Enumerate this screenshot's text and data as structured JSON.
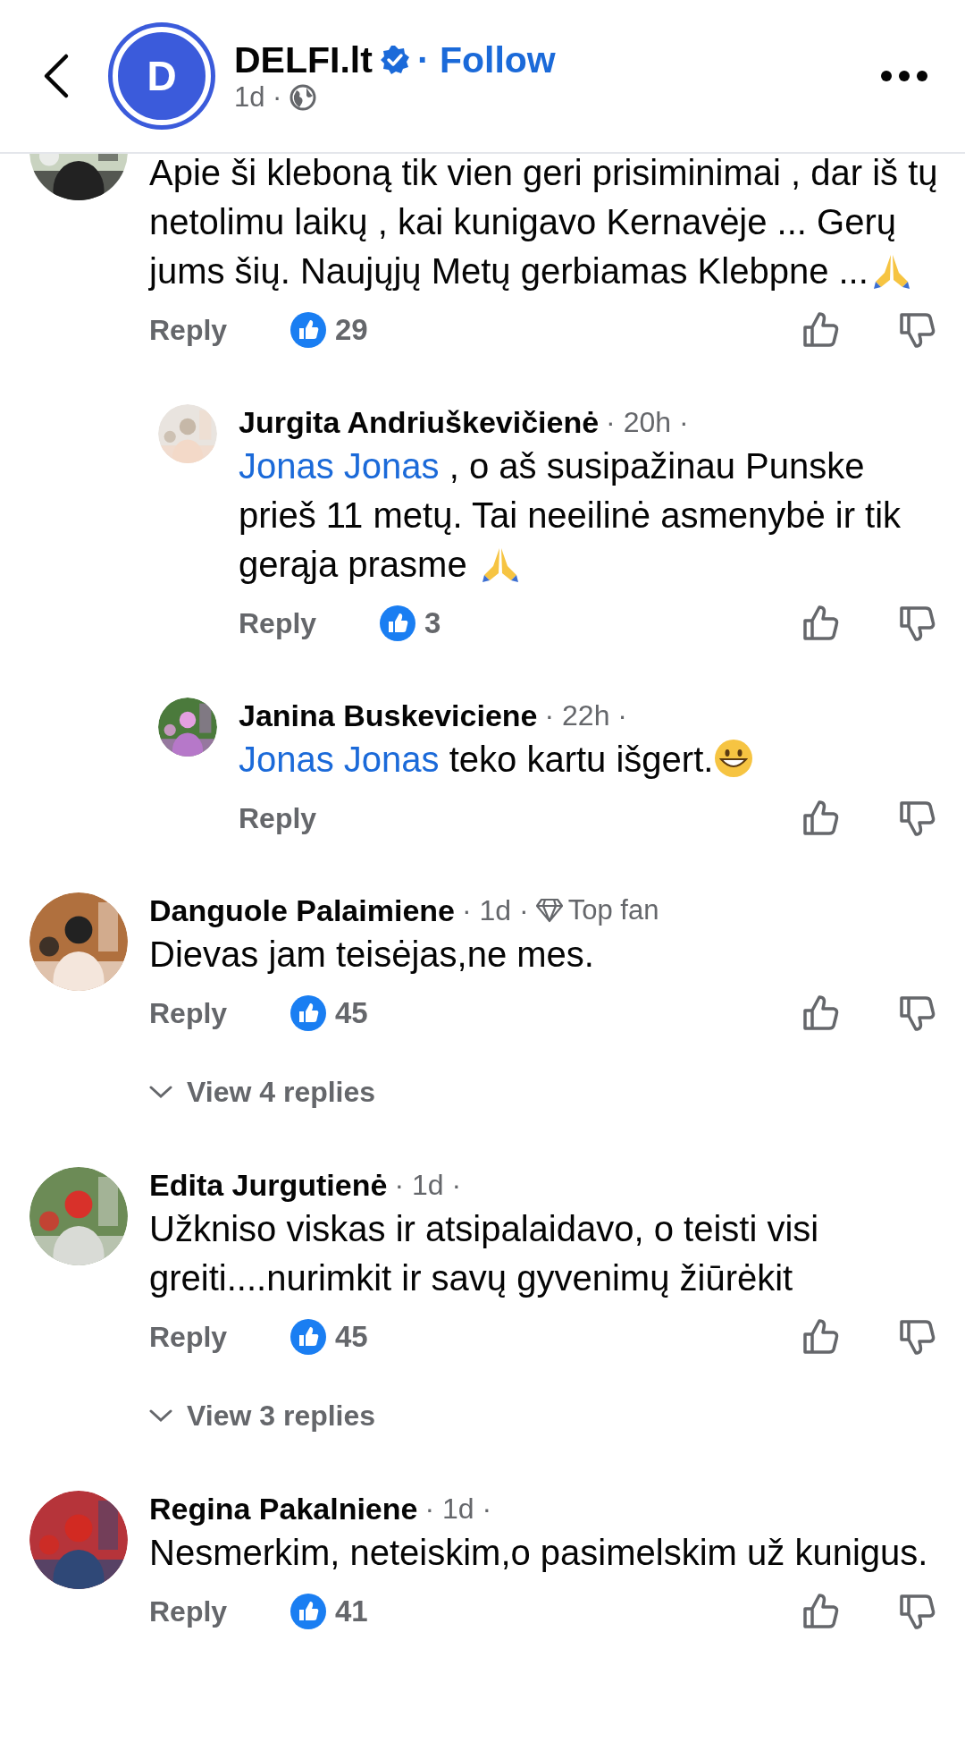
{
  "header": {
    "page_name": "DELFI.lt",
    "avatar_letter": "D",
    "verified": true,
    "follow": "· Follow",
    "age": "1d ·"
  },
  "comments": [
    {
      "kind": "top",
      "text": [
        {
          "text": "Apie ši kleboną tik vien geri prisiminimai , dar iš tų netolimu laikų , kai kunigavo Kernavėje ... Gerų jums šių. Naujųjų Metų gerbiamas Klebpne ..."
        }
      ],
      "emoji": {
        "kind": "pray"
      },
      "reply": "Reply",
      "likes": "29"
    },
    {
      "kind": "reply",
      "author": "Jurgita Andriuškevičienė",
      "meta": "· 20h ·",
      "text": [
        {
          "mention": "Jonas Jonas"
        },
        {
          "text": " , o aš susipažinau Punske prieš 11 metų. Tai neeilinė asmenybė ir tik gerąja prasme "
        }
      ],
      "emoji": {
        "kind": "pray"
      },
      "reply": "Reply",
      "likes": "3"
    },
    {
      "kind": "reply",
      "author": "Janina Buskeviciene",
      "meta": "· 22h ·",
      "text": [
        {
          "mention": "Jonas Jonas"
        },
        {
          "text": " teko kartu išgert."
        }
      ],
      "emoji": {
        "kind": "grin"
      },
      "reply": "Reply"
    },
    {
      "kind": "top",
      "author": "Danguole Palaimiene",
      "meta": "· 1d ·",
      "badge": "Top fan",
      "text": [
        {
          "text": "Dievas jam teisėjas,ne mes."
        }
      ],
      "reply": "Reply",
      "likes": "45",
      "view_replies": "View 4 replies"
    },
    {
      "kind": "top",
      "author": "Edita Jurgutienė",
      "meta": "· 1d ·",
      "text": [
        {
          "text": "Užkniso viskas ir atsipalaidavo, o teisti visi greiti....nurimkit ir savų gyvenimų žiūrėkit"
        }
      ],
      "reply": "Reply",
      "likes": "45",
      "view_replies": "View 3 replies"
    },
    {
      "kind": "top",
      "author": "Regina Pakalniene",
      "meta": "· 1d ·",
      "text": [
        {
          "text": "Nesmerkim, neteiskim,o pasimelskim už kunigus."
        }
      ],
      "reply": "Reply",
      "likes": "41"
    }
  ]
}
